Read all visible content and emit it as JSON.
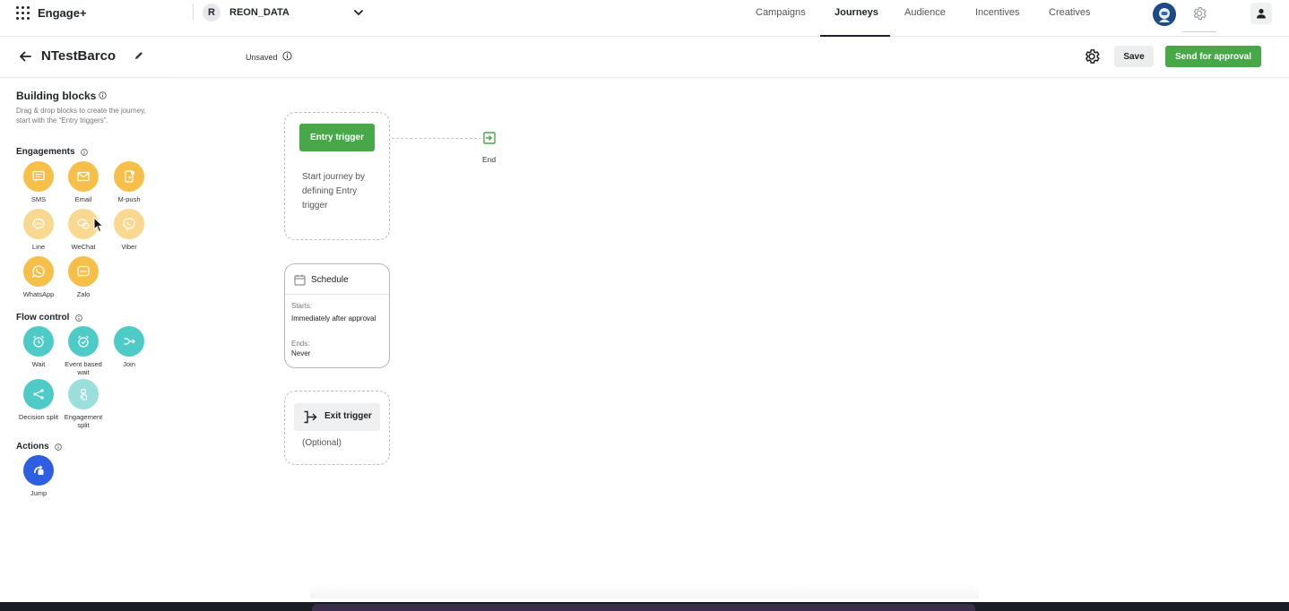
{
  "topbar": {
    "brand": "Engage+",
    "account_initial": "R",
    "account_name": "REON_DATA",
    "nav": [
      {
        "label": "Campaigns"
      },
      {
        "label": "Journeys"
      },
      {
        "label": "Audience"
      },
      {
        "label": "Incentives"
      },
      {
        "label": "Creatives"
      }
    ],
    "active_nav": "Journeys"
  },
  "subbar": {
    "journey_name": "NTestBarco",
    "status": "Unsaved",
    "save_label": "Save",
    "approve_label": "Send for approval"
  },
  "sidebar": {
    "title": "Building blocks",
    "description": "Drag & drop blocks to create the journey, start with the “Entry triggers”.",
    "engagements_title": "Engagements",
    "engagements": [
      {
        "label": "SMS",
        "icon": "sms-icon"
      },
      {
        "label": "Email",
        "icon": "email-icon"
      },
      {
        "label": "M-push",
        "icon": "mobile-push-icon"
      },
      {
        "label": "Line",
        "icon": "line-icon"
      },
      {
        "label": "WeChat",
        "icon": "wechat-icon"
      },
      {
        "label": "Viber",
        "icon": "viber-icon"
      },
      {
        "label": "WhatsApp",
        "icon": "whatsapp-icon"
      },
      {
        "label": "Zalo",
        "icon": "zalo-icon"
      }
    ],
    "flow_title": "Flow control",
    "flow": [
      {
        "label": "Wait",
        "icon": "alarm-clock-icon"
      },
      {
        "label": "Event based wait",
        "icon": "alarm-event-icon"
      },
      {
        "label": "Join",
        "icon": "join-icon"
      },
      {
        "label": "Decision split",
        "icon": "share-split-icon"
      },
      {
        "label": "Engagement split",
        "icon": "touch-split-icon"
      }
    ],
    "actions_title": "Actions",
    "actions": [
      {
        "label": "Jump",
        "icon": "jump-icon"
      }
    ]
  },
  "canvas": {
    "entry_label": "Entry trigger",
    "entry_description": "Start journey by defining Entry trigger",
    "end_label": "End",
    "schedule": {
      "title": "Schedule",
      "starts_key": "Starts:",
      "starts_value": "Immediately after approval",
      "ends_key": "Ends:",
      "ends_value": "Never"
    },
    "exit_label": "Exit trigger",
    "exit_optional": "(Optional)"
  },
  "colors": {
    "brand_green": "#47a847",
    "engagement_yellow": "#f6bf4a",
    "flow_teal": "#4ecbc7",
    "action_blue": "#2e5fe0"
  }
}
